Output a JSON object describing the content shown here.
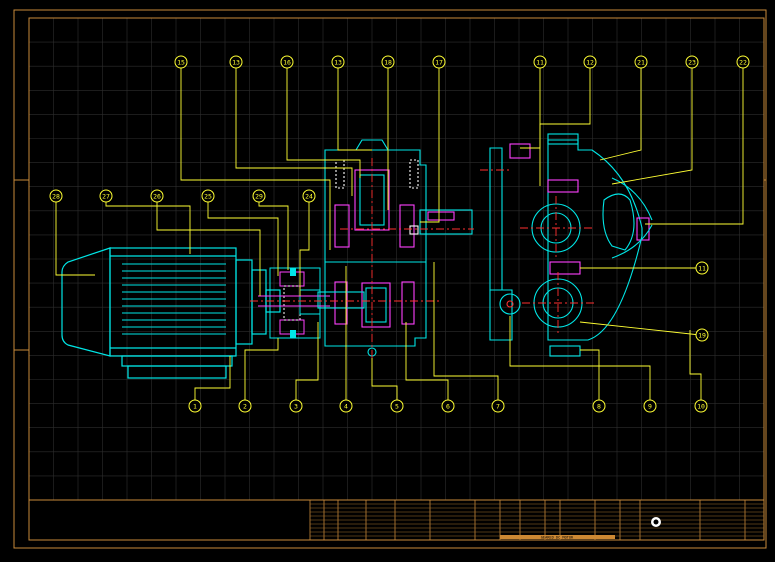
{
  "drawing": {
    "callouts_top": [
      "15",
      "13",
      "16",
      "13",
      "18",
      "17",
      "11",
      "12",
      "21",
      "23",
      "22"
    ],
    "callouts_left": [
      "28",
      "27",
      "26",
      "25",
      "29",
      "24"
    ],
    "callouts_bottom": [
      "1",
      "2",
      "3",
      "4",
      "5",
      "6",
      "7",
      "8",
      "9",
      "10"
    ],
    "callouts_right": [
      "11",
      "19"
    ],
    "title_text": "GEARED DC MOTOR",
    "colors": {
      "frame": "#c98a3a",
      "grid": "#2e2e2e",
      "outline": "#00e6e6",
      "callout": "#ffff33",
      "center": "#ff3030",
      "accent": "#ff40ff",
      "detail": "#ffffff"
    }
  }
}
